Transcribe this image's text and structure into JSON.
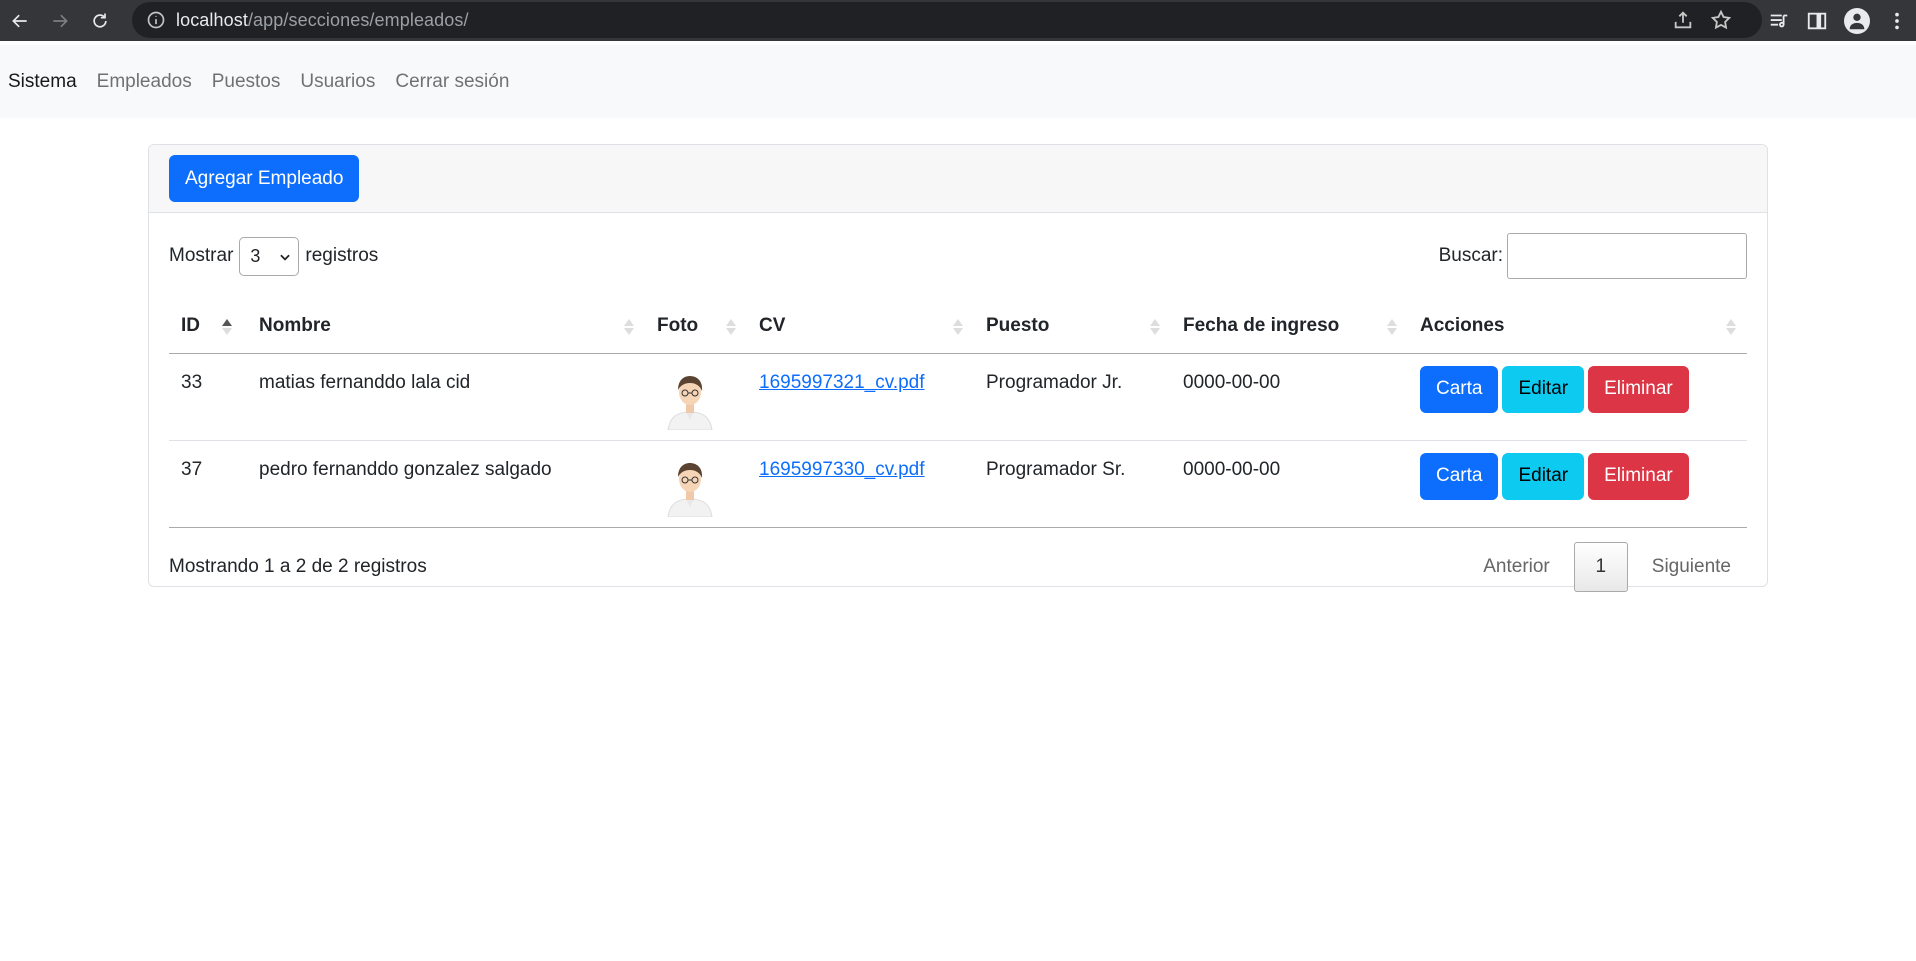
{
  "browser": {
    "url_host": "localhost",
    "url_path": "/app/secciones/empleados/"
  },
  "navbar": {
    "brand": "Sistema",
    "links": [
      "Empleados",
      "Puestos",
      "Usuarios",
      "Cerrar sesión"
    ]
  },
  "card": {
    "add_button": "Agregar Empleado"
  },
  "table_controls": {
    "show_label": "Mostrar",
    "page_length": "3",
    "records_label": "registros",
    "search_label": "Buscar:",
    "search_value": ""
  },
  "table": {
    "columns": [
      "ID",
      "Nombre",
      "Foto",
      "CV",
      "Puesto",
      "Fecha de ingreso",
      "Acciones"
    ],
    "rows": [
      {
        "id": "33",
        "nombre": "matias fernanddo lala cid",
        "cv": "1695997321_cv.pdf",
        "puesto": "Programador Jr.",
        "fecha": "0000-00-00"
      },
      {
        "id": "37",
        "nombre": "pedro fernanddo gonzalez salgado",
        "cv": "1695997330_cv.pdf",
        "puesto": "Programador Sr.",
        "fecha": "0000-00-00"
      }
    ],
    "actions": {
      "carta": "Carta",
      "editar": "Editar",
      "eliminar": "Eliminar"
    }
  },
  "footer": {
    "info": "Mostrando 1 a 2 de 2 registros",
    "prev": "Anterior",
    "current_page": "1",
    "next": "Siguiente"
  },
  "colors": {
    "primary": "#0d6efd",
    "info": "#0dcaf0",
    "danger": "#dc3545"
  }
}
